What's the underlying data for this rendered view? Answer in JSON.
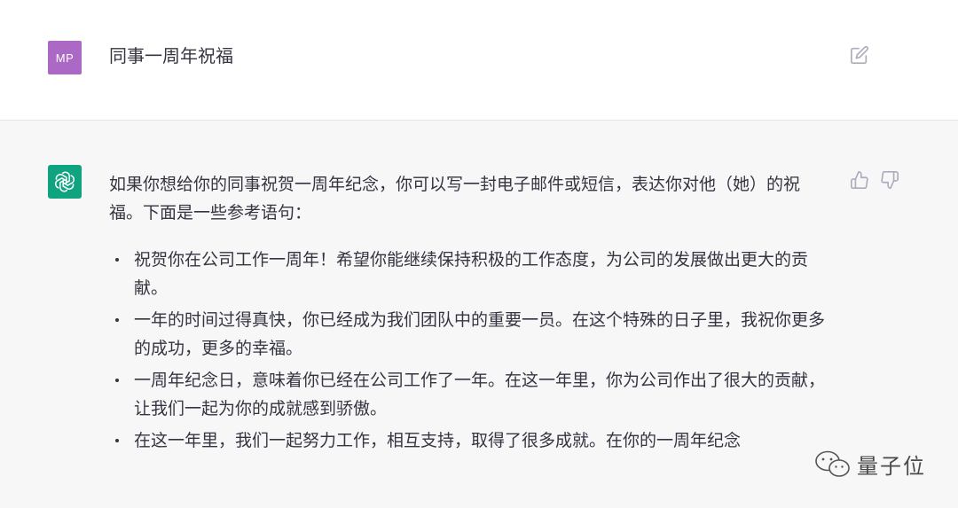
{
  "user": {
    "avatar_initials": "MP",
    "avatar_color": "#ab68c4",
    "message": "同事一周年祝福"
  },
  "assistant": {
    "avatar_color": "#10a37f",
    "avatar_icon": "openai-logo-icon",
    "intro": "如果你想给你的同事祝贺一周年纪念，你可以写一封电子邮件或短信，表达你对他（她）的祝福。下面是一些参考语句：",
    "bullets": [
      "祝贺你在公司工作一周年！希望你能继续保持积极的工作态度，为公司的发展做出更大的贡献。",
      "一年的时间过得真快，你已经成为我们团队中的重要一员。在这个特殊的日子里，我祝你更多的成功，更多的幸福。",
      "一周年纪念日，意味着你已经在公司工作了一年。在这一年里，你为公司作出了很大的贡献，让我们一起为你的成就感到骄傲。",
      "在这一年里，我们一起努力工作，相互支持，取得了很多成就。在你的一周年纪念"
    ]
  },
  "watermark": {
    "text": "量子位",
    "icon": "wechat-icon"
  }
}
